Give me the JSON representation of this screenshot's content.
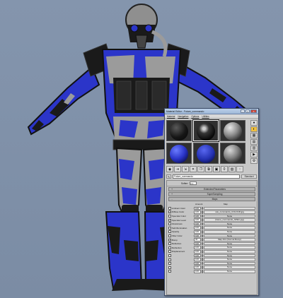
{
  "colors": {
    "background": "#7f90a8",
    "armor_blue": "#2b35c9",
    "armor_grey": "#9b9b9b",
    "armor_dark": "#1a1a1a"
  },
  "material_editor": {
    "title": "Material Editor - Future_commando",
    "menu": [
      "Material",
      "Navigation",
      "Options",
      "Utilities"
    ],
    "material_name": "Future_commando",
    "material_type": "Standard",
    "soften_label": "Soften:",
    "soften_value": "0.1",
    "rollouts": [
      "Extended Parameters",
      "SuperSampling",
      "Maps"
    ],
    "maps_header": {
      "amount": "Amount",
      "map": "Map"
    },
    "maps": [
      {
        "name": "Ambient Color",
        "amount": "100",
        "map": "",
        "checked": false
      },
      {
        "name": "Diffuse Color",
        "amount": "100",
        "map": "uav_commando_COLOUR.jpg",
        "checked": true
      },
      {
        "name": "Specular Color",
        "amount": "100",
        "map": "None",
        "checked": false
      },
      {
        "name": "Specular Level",
        "amount": "100",
        "map": "(future_commando_SPEC.jpg)",
        "checked": true
      },
      {
        "name": "Glossiness",
        "amount": "100",
        "map": "None",
        "checked": false
      },
      {
        "name": "Self-Illumination",
        "amount": "100",
        "map": "None",
        "checked": false
      },
      {
        "name": "Opacity",
        "amount": "100",
        "map": "None",
        "checked": false
      },
      {
        "name": "Filter Color",
        "amount": "100",
        "map": "None",
        "checked": false
      },
      {
        "name": "Bump",
        "amount": "30",
        "map": "Map #14 (Normal Bump)",
        "checked": true
      },
      {
        "name": "Reflection",
        "amount": "100",
        "map": "None",
        "checked": false
      },
      {
        "name": "Refraction",
        "amount": "100",
        "map": "None",
        "checked": false
      },
      {
        "name": "Displacement",
        "amount": "100",
        "map": "None",
        "checked": false
      },
      {
        "name": "",
        "amount": "100",
        "map": "None",
        "checked": false
      },
      {
        "name": "",
        "amount": "100",
        "map": "None",
        "checked": false
      },
      {
        "name": "",
        "amount": "100",
        "map": "None",
        "checked": false
      },
      {
        "name": "",
        "amount": "100",
        "map": "None",
        "checked": false
      },
      {
        "name": "",
        "amount": "100",
        "map": "None",
        "checked": false
      }
    ]
  }
}
